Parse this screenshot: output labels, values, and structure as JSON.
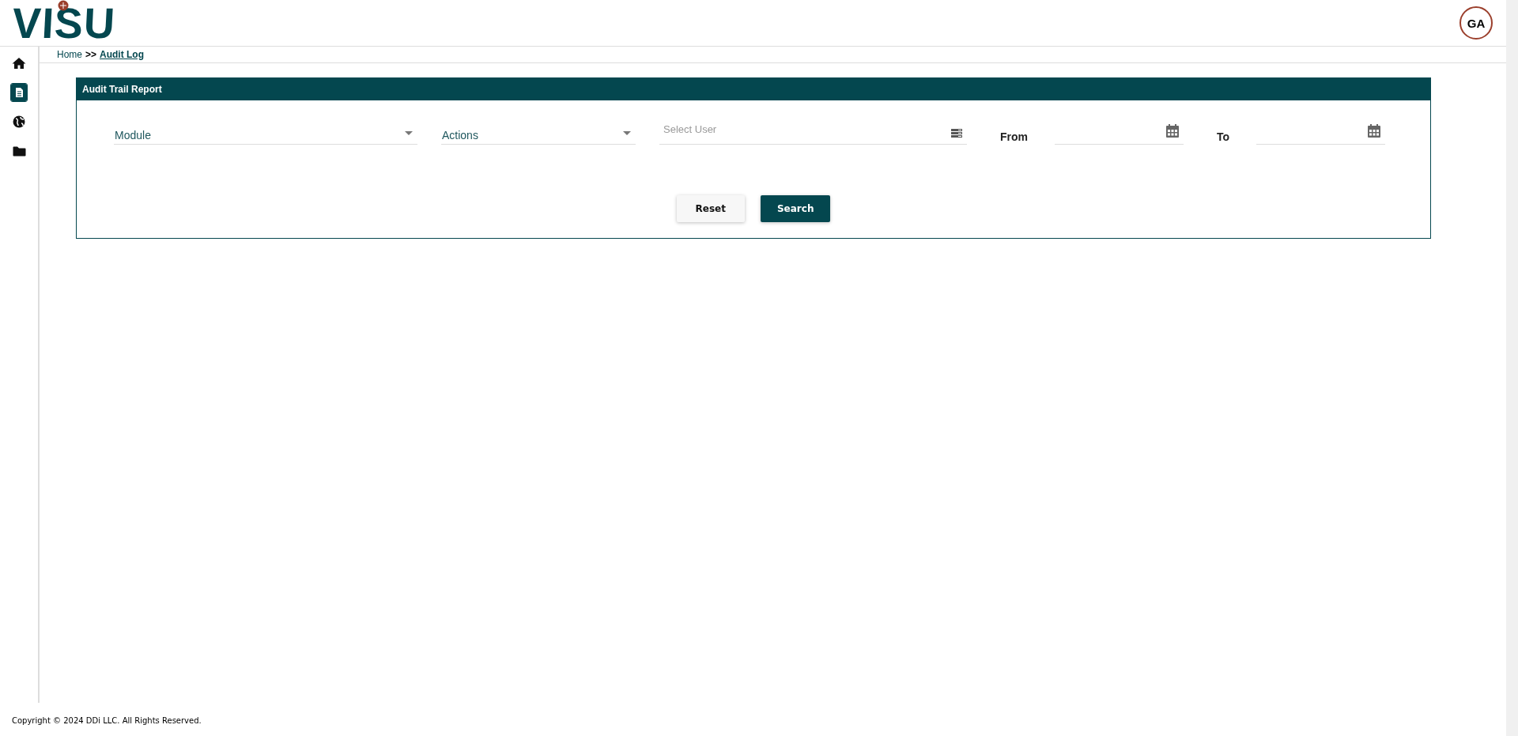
{
  "header": {
    "logo": "VISU",
    "avatar": "GA"
  },
  "sidebar": {
    "items": [
      {
        "kind": "home",
        "selected": false
      },
      {
        "kind": "document",
        "selected": true
      },
      {
        "kind": "globe",
        "selected": false
      },
      {
        "kind": "folder",
        "selected": false
      }
    ]
  },
  "breadcrumb": {
    "home": "Home",
    "separator": ">>",
    "current": "Audit Log"
  },
  "card": {
    "title": "Audit Trail Report",
    "fields": [
      {
        "kind": "dropdown",
        "value": "Module"
      },
      {
        "kind": "dropdown",
        "value": "Actions"
      },
      {
        "kind": "list",
        "placeholder": "Select User"
      },
      {
        "kind": "date",
        "label": "From"
      },
      {
        "kind": "date",
        "label": "To"
      }
    ],
    "buttons": [
      {
        "label": "Reset",
        "primary": false
      },
      {
        "label": "Search",
        "primary": true
      }
    ]
  },
  "footer": "Copyright © 2024 DDi LLC. All Rights Reserved."
}
